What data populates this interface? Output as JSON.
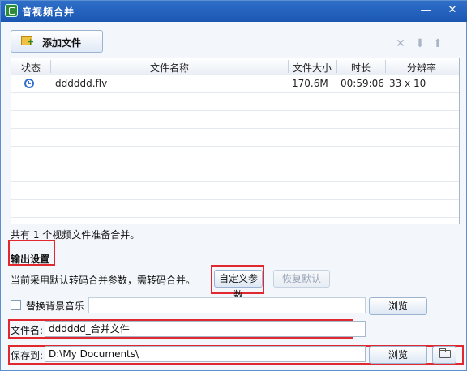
{
  "window": {
    "title": "音视频合并",
    "minimize_glyph": "—",
    "close_glyph": "✕"
  },
  "toolbar": {
    "add_label": "添加文件",
    "icons": {
      "add": "folder-add-icon",
      "remove": "delete-x-icon",
      "down": "move-down-icon",
      "up": "move-up-icon"
    }
  },
  "table": {
    "headers": {
      "status": "状态",
      "name": "文件名称",
      "size": "文件大小",
      "duration": "时长",
      "resolution": "分辨率"
    },
    "rows": [
      {
        "status_icon": "clock-icon",
        "name": "dddddd.flv",
        "size": "170.6M",
        "duration": "00:59:06",
        "resolution": "33 x 10"
      }
    ]
  },
  "summary": "共有 1 个视频文件准备合并。",
  "output": {
    "section_title": "输出设置",
    "param_text": "当前采用默认转码合并参数，需转码合并。",
    "custom_button": "自定义参数",
    "restore_button": "恢复默认",
    "bgm_label": "替换背景音乐",
    "bgm_checked": false,
    "bgm_value": "",
    "browse_label": "浏览",
    "filename_label": "文件名:",
    "filename_value": "dddddd_合并文件",
    "saveto_label": "保存到:",
    "saveto_value": "D:\\My Documents\\",
    "open_folder_icon": "open-folder-icon"
  },
  "colors": {
    "title_bar": "#1f5fbf",
    "highlight": "#e0282e",
    "window_bg": "#f3f6fb"
  }
}
